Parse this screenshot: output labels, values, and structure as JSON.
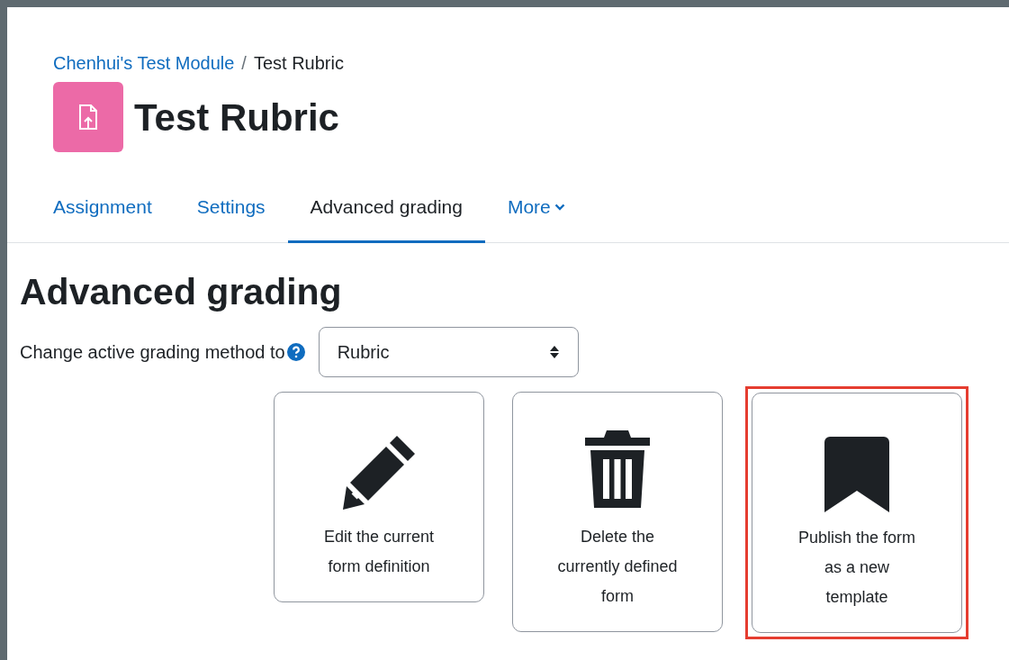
{
  "breadcrumb": [
    {
      "label": "Chenhui's Test Module",
      "link": true
    },
    {
      "label": "Test Rubric",
      "link": false
    }
  ],
  "breadcrumb_separator": "/",
  "page_title": "Test Rubric",
  "tabs": [
    {
      "label": "Assignment",
      "selected": false,
      "dropdown": false
    },
    {
      "label": "Settings",
      "selected": false,
      "dropdown": false
    },
    {
      "label": "Advanced grading",
      "selected": true,
      "dropdown": false
    },
    {
      "label": "More",
      "selected": false,
      "dropdown": true
    }
  ],
  "heading": "Advanced grading",
  "method": {
    "label": "Change active grading method to",
    "value": "Rubric"
  },
  "actions": [
    {
      "kind": "edit",
      "label": "Edit the current form definition",
      "highlighted": false
    },
    {
      "kind": "delete",
      "label": "Delete the currently defined form",
      "highlighted": false
    },
    {
      "kind": "publish",
      "label": "Publish the form as a new template",
      "highlighted": true
    }
  ]
}
